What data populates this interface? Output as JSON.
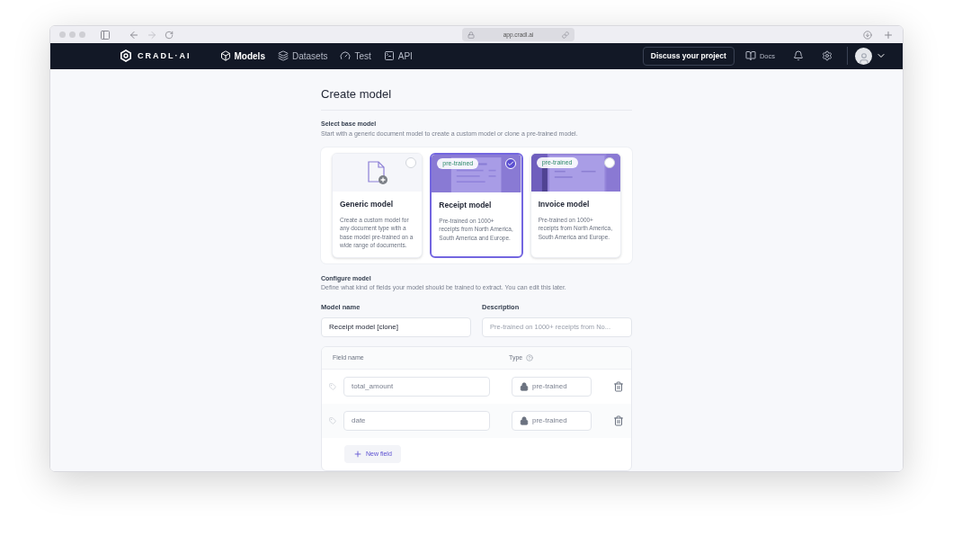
{
  "browser": {
    "url": "app.cradl.ai"
  },
  "nav": {
    "logo": "CRADL·AI",
    "items": [
      {
        "label": "Models",
        "kind": "models",
        "selected": true
      },
      {
        "label": "Datasets",
        "kind": "datasets",
        "selected": false
      },
      {
        "label": "Test",
        "kind": "test",
        "selected": false
      },
      {
        "label": "API",
        "kind": "api",
        "selected": false
      }
    ],
    "cta": "Discuss your project",
    "docs": "Docs"
  },
  "page": {
    "title": "Create model",
    "base_section": {
      "title": "Select base model",
      "description": "Start with a generic document model to create a custom model or clone a pre-trained model."
    },
    "models": [
      {
        "kind": "generic",
        "name": "Generic model",
        "description": "Create a custom model for any document type with a base model pre-trained on a wide range of documents.",
        "selected": false
      },
      {
        "kind": "receipt",
        "badge": "pre-trained",
        "name": "Receipt model",
        "description": "Pre-trained on 1000+ receipts from North America, South America and Europe.",
        "selected": true
      },
      {
        "kind": "invoice",
        "badge": "pre-trained",
        "name": "Invoice model",
        "description": "Pre-trained on 1000+ receipts from North America, South America and Europe.",
        "selected": false
      }
    ],
    "configure_section": {
      "title": "Configure model",
      "description": "Define what kind of fields your model should be trained to extract. You can edit this later."
    },
    "model_name": {
      "label": "Model name",
      "value": "Receipt model [clone]"
    },
    "description": {
      "label": "Description",
      "placeholder": "Pre-trained on 1000+ receipts from No..."
    },
    "fields_table": {
      "columns": [
        "Field name",
        "Type"
      ],
      "rows": [
        {
          "name": "total_amount",
          "type": "pre-trained"
        },
        {
          "name": "date",
          "type": "pre-trained"
        }
      ],
      "add_button": "New field"
    }
  }
}
